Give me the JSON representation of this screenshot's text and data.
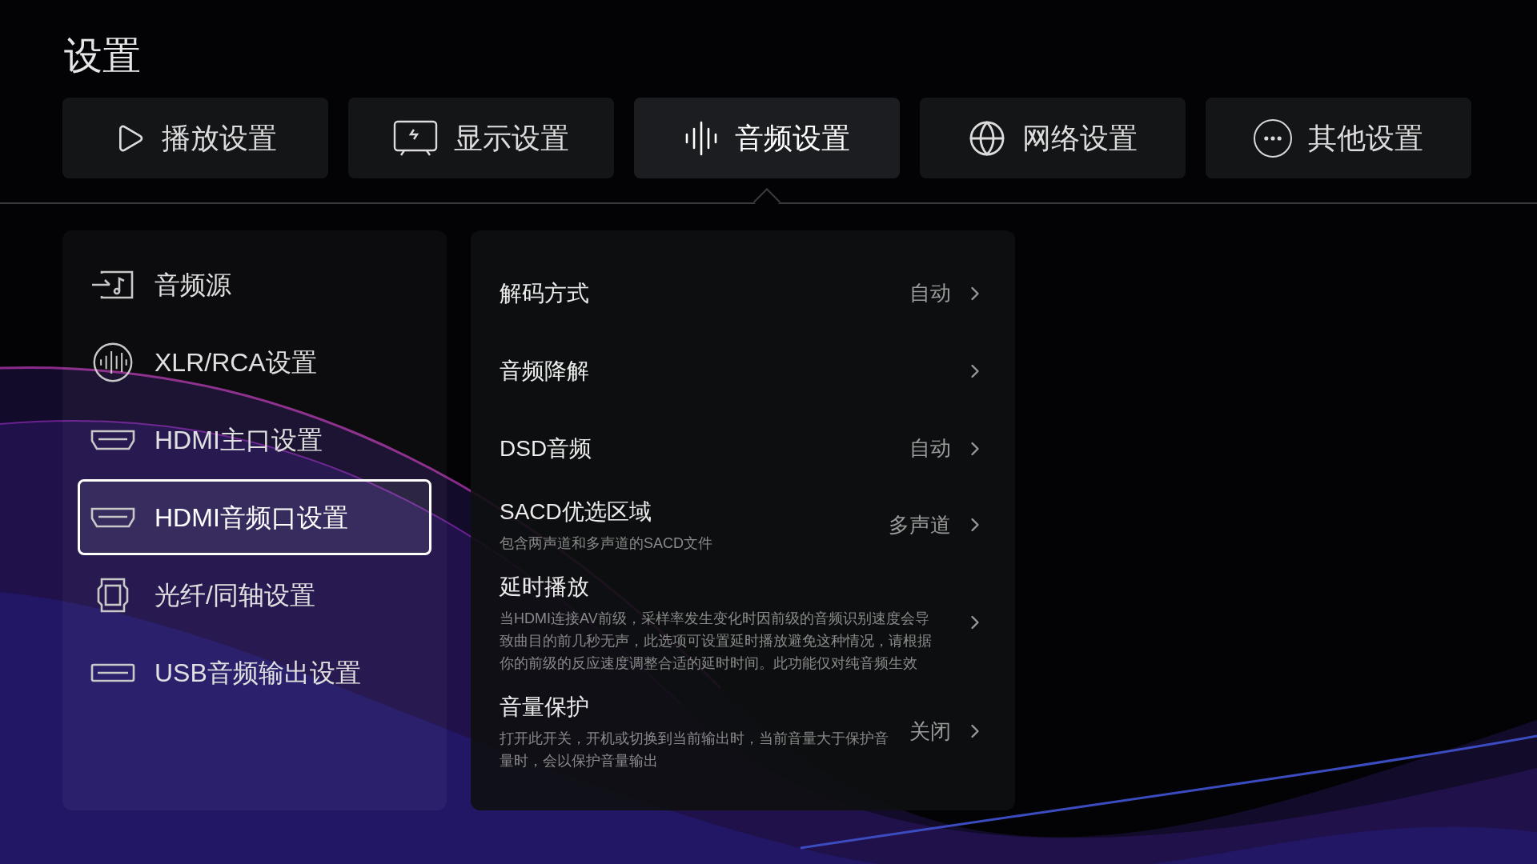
{
  "title": "设置",
  "tabs": [
    {
      "label": "播放设置",
      "kind": "play",
      "selected": false
    },
    {
      "label": "显示设置",
      "kind": "display",
      "selected": false
    },
    {
      "label": "音频设置",
      "kind": "audio",
      "selected": true
    },
    {
      "label": "网络设置",
      "kind": "network",
      "selected": false
    },
    {
      "label": "其他设置",
      "kind": "more",
      "selected": false
    }
  ],
  "sidebar": {
    "items": [
      {
        "label": "音频源",
        "kind": "source",
        "selected": false
      },
      {
        "label": "XLR/RCA设置",
        "kind": "wave",
        "selected": false
      },
      {
        "label": "HDMI主口设置",
        "kind": "hdmi",
        "selected": false
      },
      {
        "label": "HDMI音频口设置",
        "kind": "hdmi",
        "selected": true
      },
      {
        "label": "光纤/同轴设置",
        "kind": "optical",
        "selected": false
      },
      {
        "label": "USB音频输出设置",
        "kind": "usb",
        "selected": false
      }
    ]
  },
  "settings": [
    {
      "title": "解码方式",
      "value": "自动"
    },
    {
      "title": "音频降解"
    },
    {
      "title": "DSD音频",
      "value": "自动"
    },
    {
      "title": "SACD优选区域",
      "value": "多声道",
      "description": "包含两声道和多声道的SACD文件"
    },
    {
      "title": "延时播放",
      "description": "当HDMI连接AV前级，采样率发生变化时因前级的音频识别速度会导致曲目的前几秒无声，此选项可设置延时播放避免这种情况，请根据你的前级的反应速度调整合适的延时时间。此功能仅对纯音频生效"
    },
    {
      "title": "音量保护",
      "value": "关闭",
      "description": "打开此开关，开机或切换到当前输出时，当前音量大于保护音量时，会以保护音量输出"
    }
  ]
}
